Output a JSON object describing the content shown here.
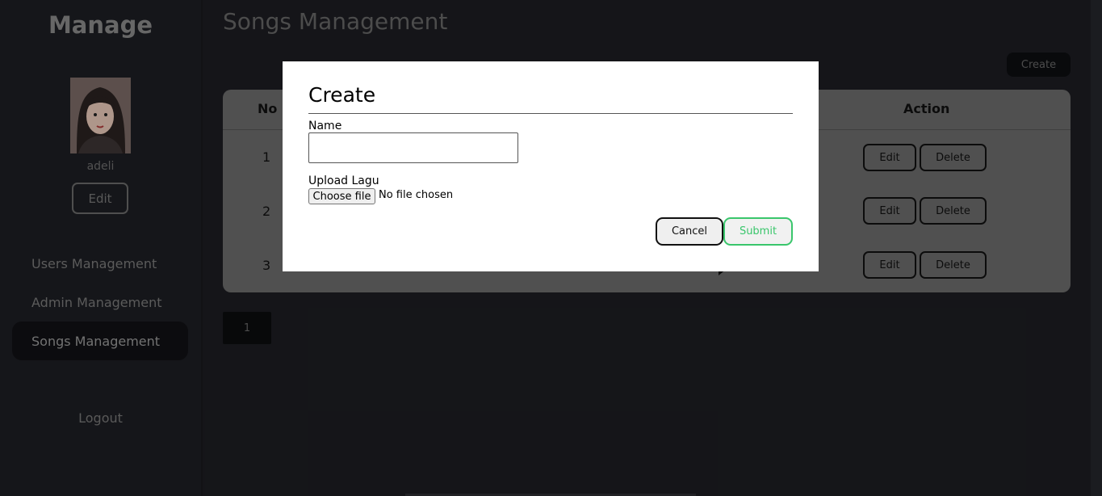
{
  "sidebar": {
    "brand": "Manage",
    "username": "adeli",
    "edit_label": "Edit",
    "nav": [
      {
        "label": "Users Management"
      },
      {
        "label": "Admin Management"
      },
      {
        "label": "Songs Management"
      }
    ],
    "logout_label": "Logout"
  },
  "main": {
    "title": "Songs Management",
    "create_label": "Create",
    "table": {
      "headers": {
        "no": "No",
        "action": "Action"
      },
      "rows": [
        {
          "no": "1",
          "edit": "Edit",
          "delete": "Delete"
        },
        {
          "no": "2",
          "edit": "Edit",
          "delete": "Delete"
        },
        {
          "no": "3",
          "edit": "Edit",
          "delete": "Delete"
        }
      ]
    },
    "pagination": {
      "current": "1"
    }
  },
  "modal": {
    "title": "Create",
    "name_label": "Name",
    "name_value": "",
    "upload_label": "Upload Lagu",
    "choose_file_label": "Choose file",
    "file_status": "No file chosen",
    "cancel_label": "Cancel",
    "submit_label": "Submit"
  },
  "colors": {
    "background": "#1c1d22",
    "sidebar_active": "#101114",
    "table_card": "#6b6b6b",
    "submit_accent": "#3ac66c"
  }
}
